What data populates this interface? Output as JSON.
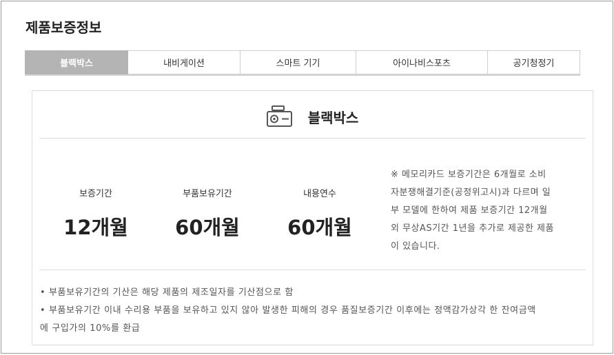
{
  "page": {
    "title": "제품보증정보"
  },
  "tabs": [
    {
      "label": "블랙박스",
      "active": true
    },
    {
      "label": "내비게이션",
      "active": false
    },
    {
      "label": "스마트 기기",
      "active": false
    },
    {
      "label": "아이나비스포츠",
      "active": false
    },
    {
      "label": "공기청정기",
      "active": false
    }
  ],
  "panel": {
    "title": "블랙박스",
    "icon": "dashcam-icon",
    "stats": [
      {
        "label": "보증기간",
        "value": "12개월"
      },
      {
        "label": "부품보유기간",
        "value": "60개월"
      },
      {
        "label": "내용연수",
        "value": "60개월"
      }
    ],
    "note_lines": [
      "※ 메모리카드 보증기간은 6개월로 소비",
      "자분쟁해결기준(공정위고시)과 다르며 일",
      "부 모델에 한하여 제품 보증기간 12개월",
      "외 무상AS기간 1년을 추가로 제공한 제품",
      "이 있습니다."
    ],
    "bullets": [
      "• 부품보유기간의 기산은 해당 제품의 제조일자를 기산점으로 함",
      "• 부품보유기간 이내 수리용 부품을 보유하고 있지 않아 발생한 피해의 경우 품질보증기간 이후에는 정액감가상각 한 잔여금액",
      "에 구입가의 10%를 환급"
    ]
  },
  "colors": {
    "active_tab_bg": "#b4b4b4",
    "border": "#dcdcdc",
    "text": "#333333"
  }
}
